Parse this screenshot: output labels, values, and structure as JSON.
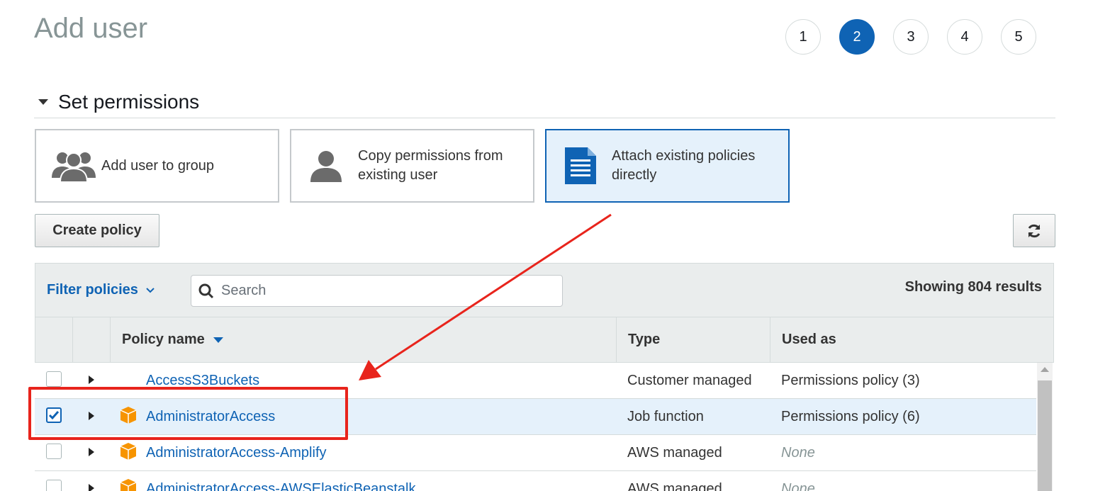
{
  "header": {
    "title": "Add user"
  },
  "steps": [
    {
      "label": "1",
      "active": false
    },
    {
      "label": "2",
      "active": true
    },
    {
      "label": "3",
      "active": false
    },
    {
      "label": "4",
      "active": false
    },
    {
      "label": "5",
      "active": false
    }
  ],
  "section": {
    "title": "Set permissions"
  },
  "options": [
    {
      "label": "Add user to group",
      "icon": "group-icon",
      "selected": false
    },
    {
      "label": "Copy permissions from existing user",
      "icon": "user-icon",
      "selected": false
    },
    {
      "label": "Attach existing policies directly",
      "icon": "document-icon",
      "selected": true
    }
  ],
  "toolbar": {
    "create_policy_label": "Create policy",
    "refresh_icon": "refresh-icon"
  },
  "filter": {
    "label": "Filter policies",
    "search_placeholder": "Search",
    "results_text": "Showing 804 results"
  },
  "table": {
    "columns": [
      "Policy name",
      "Type",
      "Used as"
    ],
    "sort_column": "Policy name",
    "rows": [
      {
        "name": "AccessS3Buckets",
        "type": "Customer managed",
        "used_as": "Permissions policy (3)",
        "checked": false,
        "icon": null
      },
      {
        "name": "AdministratorAccess",
        "type": "Job function",
        "used_as": "Permissions policy (6)",
        "checked": true,
        "icon": "package-icon"
      },
      {
        "name": "AdministratorAccess-Amplify",
        "type": "AWS managed",
        "used_as": "None",
        "checked": false,
        "icon": "package-icon"
      },
      {
        "name": "AdministratorAccess-AWSElasticBeanstalk",
        "type": "AWS managed",
        "used_as": "None",
        "checked": false,
        "icon": "package-icon"
      }
    ]
  },
  "colors": {
    "accent": "#0f63b4",
    "annotation": "#e8241c",
    "package": "#f79400"
  }
}
